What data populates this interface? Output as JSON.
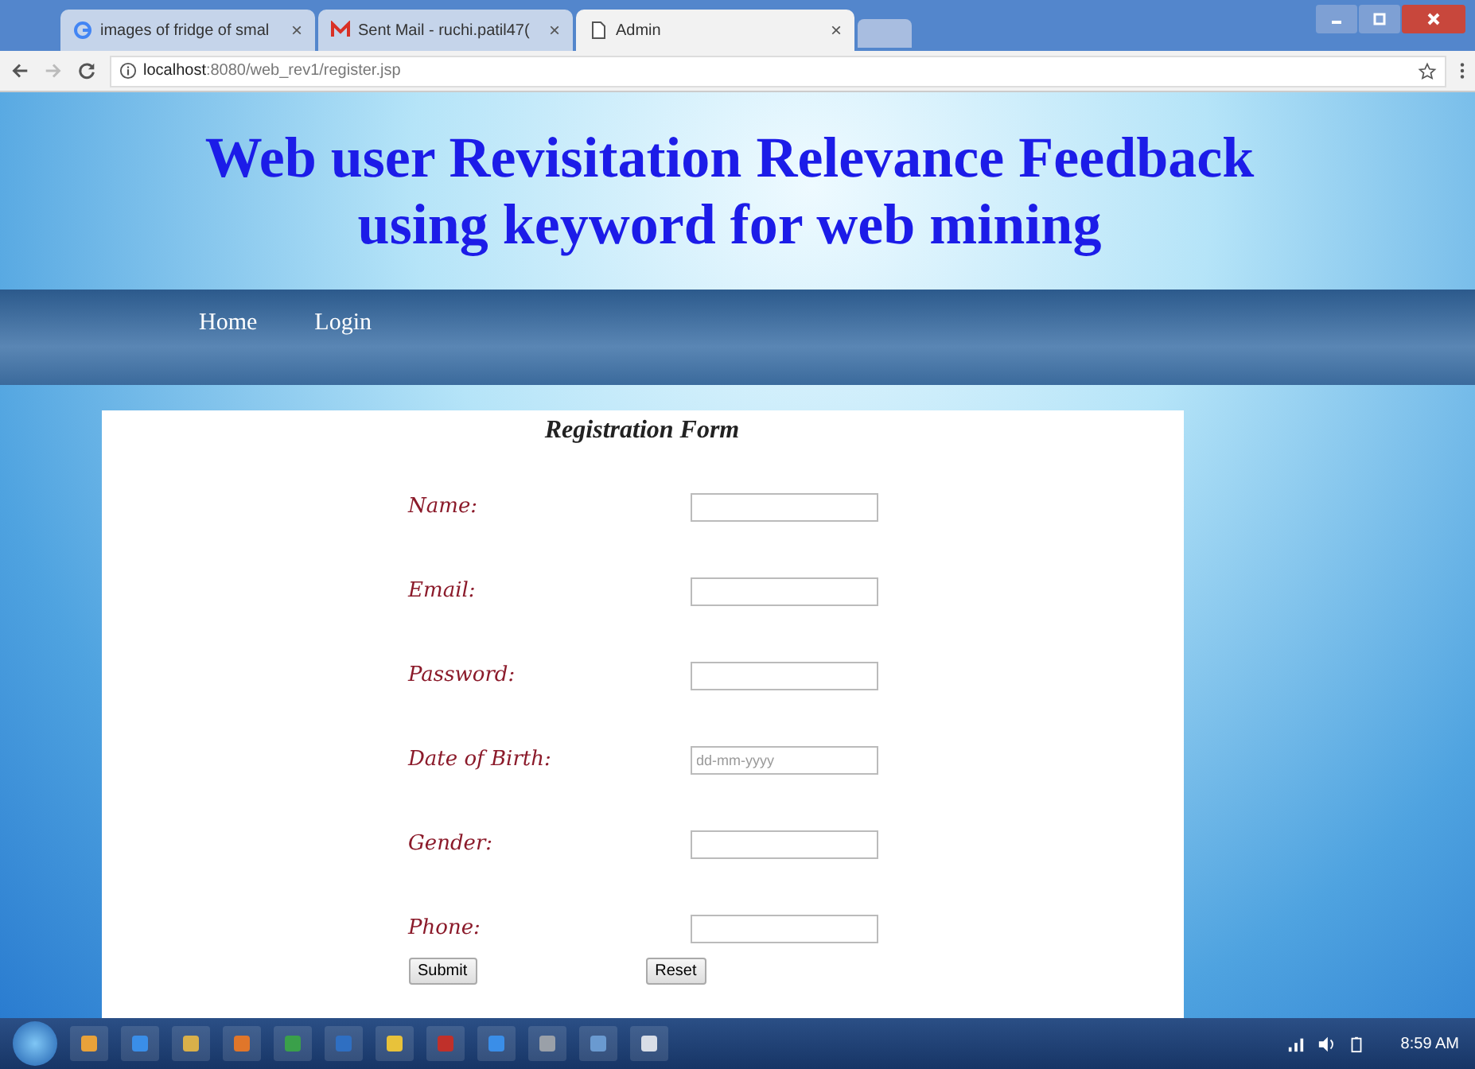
{
  "browser": {
    "tabs": [
      {
        "kind": "google",
        "label": "images of fridge of smal",
        "close": "×",
        "selected": false
      },
      {
        "kind": "mail",
        "label": "Sent Mail - ruchi.patil47(",
        "close": "×",
        "selected": false
      },
      {
        "kind": "page",
        "label": "Admin",
        "close": "×",
        "selected": true
      }
    ],
    "url": "**localhost**:8080/web_rev1/register.jsp"
  },
  "page": {
    "title_lines": [
      "Web user Revisitation Relevance Feedback",
      "using keyword for web mining"
    ],
    "nav": [
      "Home",
      "Login"
    ],
    "form": {
      "title": "Registration Form",
      "fields": [
        {
          "label": "Name:"
        },
        {
          "label": "Email:"
        },
        {
          "label": "Password:"
        },
        {
          "label": "Date of Birth:",
          "placeholder": "dd-mm-yyyy"
        },
        {
          "label": "Gender:"
        },
        {
          "label": "Phone:"
        }
      ],
      "buttons": [
        "Submit",
        "Reset"
      ]
    }
  },
  "taskbar": {
    "clock": "8:59 AM"
  }
}
